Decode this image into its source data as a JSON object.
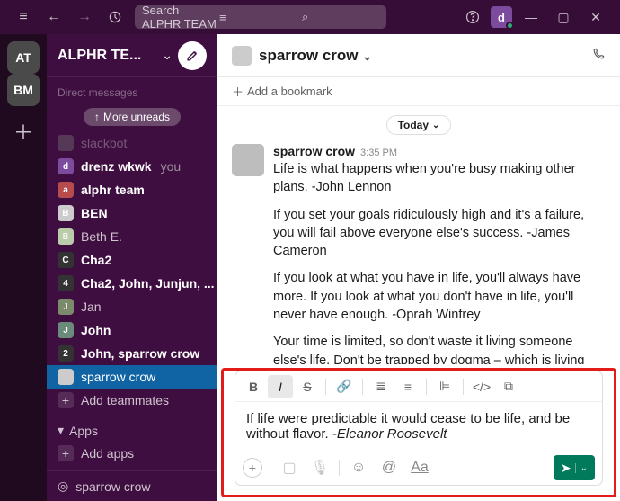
{
  "topbar": {
    "search_placeholder": "Search ALPHR TEAM",
    "user_initial": "d"
  },
  "rail": {
    "workspaces": [
      "AT",
      "BM"
    ]
  },
  "sidebar": {
    "workspace_name": "ALPHR TE...",
    "more_unreads": "More unreads",
    "truncated_items": [
      "Direct messages",
      "slackbot"
    ],
    "dms": [
      {
        "label": "drenz wkwk",
        "you": "you",
        "initial": "d",
        "bold": true,
        "bg": "#7d4b9e"
      },
      {
        "label": "alphr team",
        "initial": "a",
        "bold": true,
        "bg": "#b84c4c"
      },
      {
        "label": "BEN",
        "initial": "B",
        "bold": true,
        "bg": "#ccc"
      },
      {
        "label": "Beth E.",
        "initial": "B",
        "bold": false,
        "bg": "#bca"
      },
      {
        "label": "Cha2",
        "initial": "C",
        "bold": true,
        "bg": "#333"
      },
      {
        "label": "Cha2, John, Junjun, ...",
        "initial": "4",
        "bold": true,
        "bg": "#333"
      },
      {
        "label": "Jan",
        "initial": "J",
        "bold": false,
        "bg": "#7a8a6a"
      },
      {
        "label": "John",
        "initial": "J",
        "bold": true,
        "bg": "#6a8a7a"
      },
      {
        "label": "John, sparrow crow",
        "initial": "2",
        "bold": true,
        "bg": "#333"
      },
      {
        "label": "sparrow crow",
        "initial": "",
        "bold": false,
        "bg": "#ccc",
        "active": true
      }
    ],
    "add_teammates": "Add teammates",
    "apps_label": "Apps",
    "add_apps": "Add apps",
    "footer_name": "sparrow crow"
  },
  "channel": {
    "name": "sparrow crow",
    "bookmark": "Add a bookmark",
    "today": "Today"
  },
  "message": {
    "author": "sparrow crow",
    "time": "3:35 PM",
    "paras": [
      "Life is what happens when you're busy making other plans. -John Lennon",
      "If you set your goals ridiculously high and it's a failure, you will fail above everyone else's success. -James Cameron",
      "If you look at what you have in life, you'll always have more. If you look at what you don't have in life, you'll never have enough. -Oprah Winfrey",
      "Your time is limited, so don't waste it living someone else's life. Don't be trapped by dogma – which is living with the results of other people's thinking. -Steve Jobs"
    ]
  },
  "composer": {
    "text_plain": "If life were predictable it would cease to be life, and be without flavor. ",
    "text_italic": "-Eleanor Roosevelt"
  }
}
